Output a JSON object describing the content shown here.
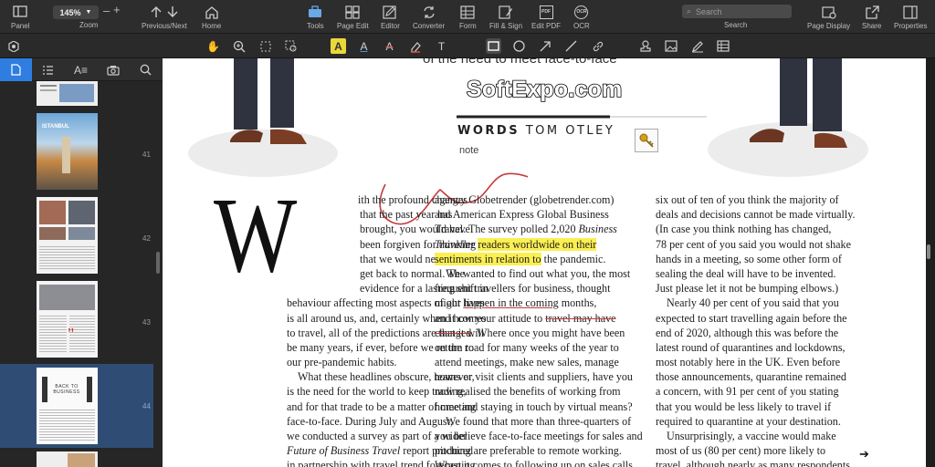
{
  "toolbar": {
    "panel_label": "Panel",
    "zoom_value": "145%",
    "zoom_label": "Zoom",
    "prevnext_label": "Previous/Next",
    "home_label": "Home",
    "tools_label": "Tools",
    "pageedit_label": "Page Edit",
    "editor_label": "Editor",
    "converter_label": "Converter",
    "form_label": "Form",
    "fillsign_label": "Fill & Sign",
    "editpdf_label": "Edit PDF",
    "ocr_label": "OCR",
    "search_placeholder": "Search",
    "search_label": "Search",
    "pagedisplay_label": "Page Display",
    "share_label": "Share",
    "properties_label": "Properties",
    "ocr_icon_text": "OCR",
    "pdf_icon_text": "PDF"
  },
  "annot_tools": [
    "settings-icon",
    "hand-icon",
    "zoom-in-icon",
    "select-icon",
    "area-select-icon",
    "highlight-icon",
    "text-color-icon",
    "strikeout-icon",
    "eraser-icon",
    "text-icon",
    "rectangle-icon",
    "circle-icon",
    "arrow-icon",
    "line-icon",
    "link-icon",
    "stamp-icon",
    "image-icon",
    "signature-icon",
    "table-icon"
  ],
  "annot_text": {
    "highlight": "A",
    "text_color": "A",
    "strike": "A",
    "text": "T"
  },
  "sidebar": {
    "tabs": [
      "page-thumbnails",
      "outline",
      "text-style",
      "snapshot",
      "search"
    ],
    "page_numbers": [
      "41",
      "42",
      "43",
      "44"
    ],
    "thumb_text": {
      "p41_title": "ISTANBUL",
      "p44_title": "BACK TO BUSINESS"
    }
  },
  "watermark": "SoftExpo.com",
  "article": {
    "headline_fragment": "of the need to meet face-to-face",
    "byline_prefix": "WORDS",
    "byline_name": "TOM OTLEY",
    "note": "note",
    "dropcap": "W",
    "col1": [
      "ith the profound changes",
      "that the past year has",
      "brought, you would have",
      "been forgiven for thinking",
      "that we would never",
      "get back to normal. The",
      "evidence for a lasting shift in",
      "behaviour affecting most aspects of our lives",
      "is all around us, and, certainly when it comes",
      "to travel, all of the predictions are that it will",
      "be many years, if ever, before we return to",
      "our pre-pandemic habits.",
      "What these headlines obscure, however,",
      "is the need for the world to keep trading,",
      "and for that trade to be a matter of meeting",
      "face-to-face. During July and August,",
      "we conducted a survey as part of a wider",
      "Future of Business Travel report produced",
      "in partnership with travel trend forecasting"
    ],
    "col2": {
      "l1": "agency Globetrender (globetrender.com)",
      "l2": "and American Express Global Business",
      "l3": "Travel. The survey polled 2,020 ",
      "l3_italic": "Business",
      "l4_italic": "Traveller",
      "l4_plain": " ",
      "l4_hl": "readers worldwide on their",
      "l5_hl": "sentiments in relation to",
      "l5_plain": " the pandemic.",
      "l6": "We wanted to find out what you, the most",
      "l7": "frequent travellers for business, thought",
      "l8_a": "might ",
      "l8_u": "happen in the coming",
      "l8_b": " months,",
      "l9_a": "and how your attitude to ",
      "l9_s": "travel may have",
      "l10_s": "changed",
      "l10_b": ". Where once you might have been",
      "l11": "on the road for many weeks of the year to",
      "l12": "attend meetings, make new sales, manage",
      "l13": "teams or visit clients and suppliers, have you",
      "l14": "now realised the benefits of working from",
      "l15": "home and staying in touch by virtual means?",
      "l16": "We found that more than three-quarters of",
      "l17": "you believe face-to-face meetings for sales and",
      "l18": "pitching are preferable to remote working.",
      "l19": "When it comes to following up on sales calls,"
    },
    "col3": [
      "six out of ten of you think the majority of",
      "deals and decisions cannot be made virtually.",
      "(In case you think nothing has changed,",
      "78 per cent of you said you would not shake",
      "hands in a meeting, so some other form of",
      "sealing the deal will have to be invented.",
      "Just please let it not be bumping elbows.)",
      "Nearly 40 per cent of you said that you",
      "expected to start travelling again before the",
      "end of 2020, although this was before the",
      "latest round of quarantines and lockdowns,",
      "most notably here in the UK. Even before",
      "those announcements, quarantine remained",
      "a concern, with 91 per cent of you stating",
      "that you would be less likely to travel if",
      "required to quarantine at your destination.",
      "Unsurprisingly, a vaccine would make",
      "most of us (80 per cent) more likely to",
      "travel, although nearly as many respondents"
    ],
    "next_arrow": "➔"
  }
}
